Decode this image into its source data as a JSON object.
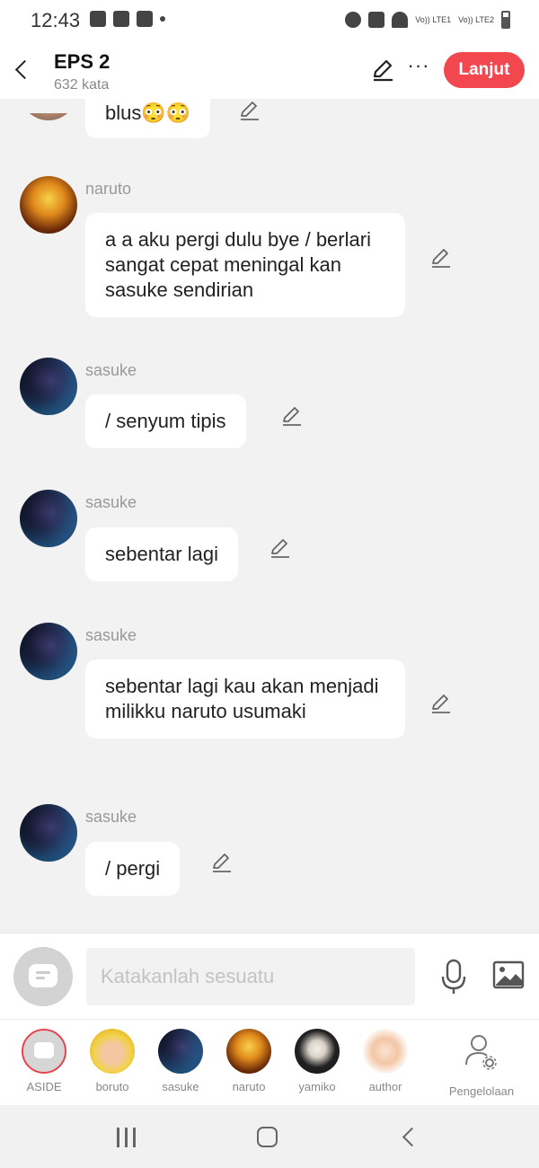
{
  "status_bar": {
    "time": "12:43",
    "sim1": "Vo)) LTE1",
    "sim2": "Vo)) LTE2"
  },
  "header": {
    "title": "EPS 2",
    "word_count": "632 kata",
    "next_button": "Lanjut",
    "more_label": "···"
  },
  "messages": [
    {
      "speaker": "",
      "text": "blus😳😳"
    },
    {
      "speaker": "naruto",
      "text": "a a aku pergi dulu bye / berlari sangat cepat meningal kan sasuke sendirian"
    },
    {
      "speaker": "sasuke",
      "text": "/ senyum tipis"
    },
    {
      "speaker": "sasuke",
      "text": "sebentar lagi"
    },
    {
      "speaker": "sasuke",
      "text": "sebentar lagi kau akan menjadi milikku  naruto usumaki"
    },
    {
      "speaker": "sasuke",
      "text": "/ pergi"
    }
  ],
  "composer": {
    "placeholder": "Katakanlah sesuatu"
  },
  "characters": [
    {
      "label": "ASIDE"
    },
    {
      "label": "boruto"
    },
    {
      "label": "sasuke"
    },
    {
      "label": "naruto"
    },
    {
      "label": "yamiko"
    },
    {
      "label": "author"
    },
    {
      "label": "Pengelolaan"
    }
  ],
  "colors": {
    "accent": "#f2474f",
    "background": "#f2f2f2",
    "bubble": "#ffffff",
    "speaker_name": "#999999"
  },
  "icons": [
    "back-icon",
    "edit-pencil-icon",
    "more-icon",
    "microphone-icon",
    "image-icon",
    "chat-bubble-icon",
    "manage-user-icon"
  ]
}
